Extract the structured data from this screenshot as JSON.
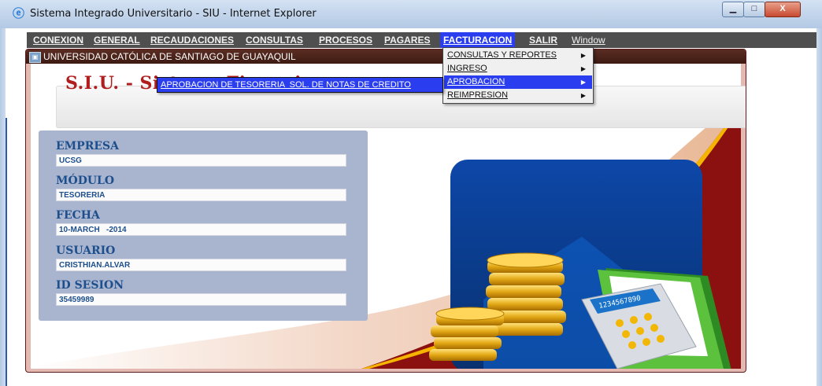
{
  "window": {
    "title": "Sistema Integrado Universitario - SIU - Internet Explorer",
    "minimize": "▁",
    "maximize": "□",
    "close": "X"
  },
  "menubar": {
    "items": [
      "CONEXION",
      "GENERAL",
      "RECAUDACIONES",
      "CONSULTAS",
      "PROCESOS",
      "PAGARES",
      "FACTURACION",
      "SALIR",
      "Window"
    ],
    "active": "FACTURACION"
  },
  "dropdown": {
    "items": [
      {
        "label": "CONSULTAS Y REPORTES",
        "arrow": "▶"
      },
      {
        "label": "INGRESO",
        "arrow": "▶"
      },
      {
        "label": "APROBACION",
        "arrow": "▶"
      },
      {
        "label": "REIMPRESION",
        "arrow": "▶"
      }
    ],
    "selected": "APROBACION"
  },
  "submenu": {
    "items": [
      "APROBACION DE TESORERIA  SOL. DE NOTAS DE CREDITO"
    ]
  },
  "panel": {
    "header": "UNIVERSIDAD CATÓLICA DE SANTIAGO DE GUAYAQUIL",
    "system_title": "S.I.U. - Sistema Financiero"
  },
  "info": {
    "fields": [
      {
        "label": "EMPRESA",
        "value": "UCSG"
      },
      {
        "label": "MÓDULO",
        "value": "TESORERIA"
      },
      {
        "label": "FECHA",
        "value": "10-MARCH   -2014"
      },
      {
        "label": "USUARIO",
        "value": "CRISTHIAN.ALVAR"
      },
      {
        "label": "ID SESION",
        "value": "35459989"
      }
    ]
  },
  "calculator": {
    "display": "1234567890"
  },
  "colors": {
    "accent": "#2a3ef0",
    "maroon": "#8b1010",
    "gold": "#f5b400",
    "dark_blue": "#0b3d91",
    "green": "#5cc13c"
  }
}
